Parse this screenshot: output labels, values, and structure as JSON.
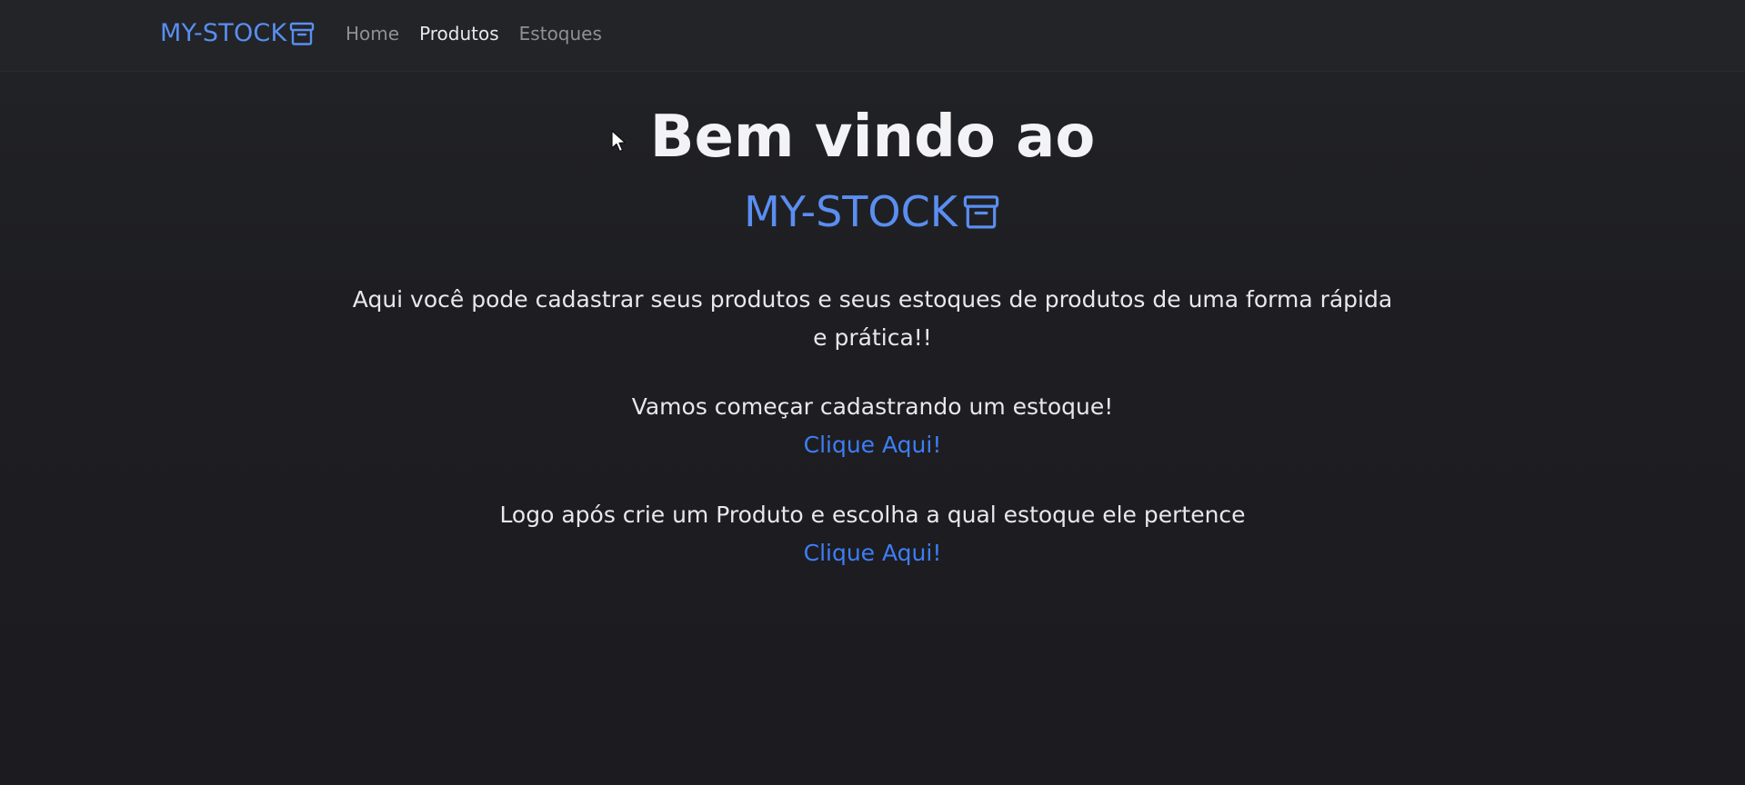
{
  "navbar": {
    "brand": "MY-STOCK",
    "brand_icon": "archive-box-icon",
    "links": [
      {
        "label": "Home",
        "active": false
      },
      {
        "label": "Produtos",
        "active": true
      },
      {
        "label": "Estoques",
        "active": false
      }
    ]
  },
  "hero": {
    "title": "Bem vindo ao",
    "brand": "MY-STOCK",
    "brand_icon": "archive-box-icon"
  },
  "content": {
    "intro_line1": "Aqui você pode cadastrar seus produtos e seus estoques de produtos de uma forma rápida",
    "intro_line2": "e prática!!",
    "step1_text": "Vamos começar cadastrando um estoque!",
    "step1_link": "Clique Aqui!",
    "step2_text": "Logo após crie um Produto e escolha a qual estoque ele pertence",
    "step2_link": "Clique Aqui!"
  },
  "colors": {
    "background": "#1d1d21",
    "navbar": "#222428",
    "brand": "#5a8ef0",
    "link": "#3d7ef5",
    "text": "#e8e8ea"
  }
}
